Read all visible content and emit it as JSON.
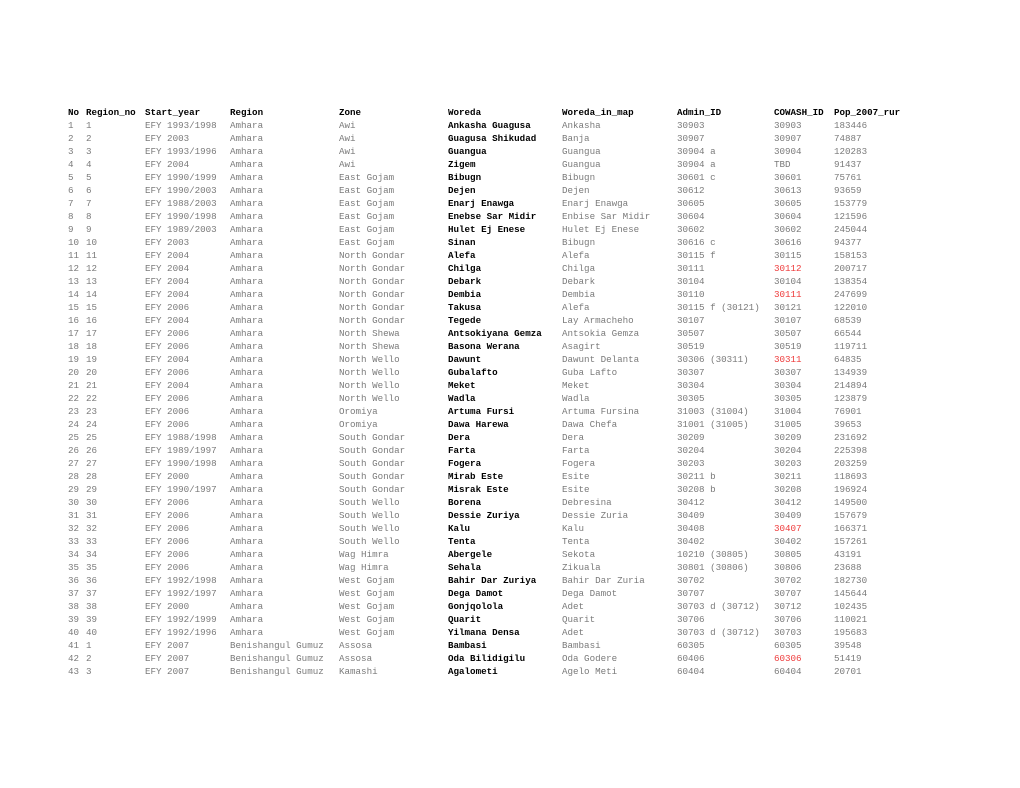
{
  "table": {
    "headers": [
      "No",
      "Region_no",
      "Start_year",
      "Region",
      "Zone",
      "Woreda",
      "Woreda_in_map",
      "Admin_ID",
      "COWASH_ID",
      "Pop_2007_rur"
    ],
    "flag_color": "#ee3b3b",
    "rows": [
      {
        "no": "1",
        "region_no": "1",
        "start_year": "EFY 1993/1998",
        "region": "Amhara",
        "zone": "Awi",
        "woreda": "Ankasha Guagusa",
        "woreda_in_map": "Ankasha",
        "admin_id": "30903",
        "cowash_id": "30903",
        "cowash_flag": false,
        "pop": "183446"
      },
      {
        "no": "2",
        "region_no": "2",
        "start_year": "EFY 2003",
        "region": "Amhara",
        "zone": "Awi",
        "woreda": "Guagusa Shikudad",
        "woreda_in_map": "Banja",
        "admin_id": "30907",
        "cowash_id": "30907",
        "cowash_flag": false,
        "pop": "74887"
      },
      {
        "no": "3",
        "region_no": "3",
        "start_year": "EFY 1993/1996",
        "region": "Amhara",
        "zone": "Awi",
        "woreda": "Guangua",
        "woreda_in_map": "Guangua",
        "admin_id": "30904 a",
        "cowash_id": "30904",
        "cowash_flag": false,
        "pop": "120283"
      },
      {
        "no": "4",
        "region_no": "4",
        "start_year": "EFY 2004",
        "region": "Amhara",
        "zone": "Awi",
        "woreda": "Zigem",
        "woreda_in_map": "Guangua",
        "admin_id": "30904 a",
        "cowash_id": "TBD",
        "cowash_flag": false,
        "pop": "91437"
      },
      {
        "no": "5",
        "region_no": "5",
        "start_year": "EFY 1990/1999",
        "region": "Amhara",
        "zone": "East Gojam",
        "woreda": "Bibugn",
        "woreda_in_map": "Bibugn",
        "admin_id": "30601 c",
        "cowash_id": "30601",
        "cowash_flag": false,
        "pop": "75761"
      },
      {
        "no": "6",
        "region_no": "6",
        "start_year": "EFY 1990/2003",
        "region": "Amhara",
        "zone": "East Gojam",
        "woreda": "Dejen",
        "woreda_in_map": "Dejen",
        "admin_id": "30612",
        "cowash_id": "30613",
        "cowash_flag": false,
        "pop": "93659"
      },
      {
        "no": "7",
        "region_no": "7",
        "start_year": "EFY 1988/2003",
        "region": "Amhara",
        "zone": "East Gojam",
        "woreda": "Enarj Enawga",
        "woreda_in_map": "Enarj Enawga",
        "admin_id": "30605",
        "cowash_id": "30605",
        "cowash_flag": false,
        "pop": "153779"
      },
      {
        "no": "8",
        "region_no": "8",
        "start_year": "EFY 1990/1998",
        "region": "Amhara",
        "zone": "East Gojam",
        "woreda": "Enebse Sar Midir",
        "woreda_in_map": "Enbise Sar Midir",
        "admin_id": "30604",
        "cowash_id": "30604",
        "cowash_flag": false,
        "pop": "121596"
      },
      {
        "no": "9",
        "region_no": "9",
        "start_year": "EFY 1989/2003",
        "region": "Amhara",
        "zone": "East Gojam",
        "woreda": "Hulet Ej Enese",
        "woreda_in_map": "Hulet Ej Enese",
        "admin_id": "30602",
        "cowash_id": "30602",
        "cowash_flag": false,
        "pop": "245044"
      },
      {
        "no": "10",
        "region_no": "10",
        "start_year": "EFY 2003",
        "region": "Amhara",
        "zone": "East Gojam",
        "woreda": "Sinan",
        "woreda_in_map": "Bibugn",
        "admin_id": "30616 c",
        "cowash_id": "30616",
        "cowash_flag": false,
        "pop": "94377"
      },
      {
        "no": "11",
        "region_no": "11",
        "start_year": "EFY 2004",
        "region": "Amhara",
        "zone": "North Gondar",
        "woreda": "Alefa",
        "woreda_in_map": "Alefa",
        "admin_id": "30115 f",
        "cowash_id": "30115",
        "cowash_flag": false,
        "pop": "158153"
      },
      {
        "no": "12",
        "region_no": "12",
        "start_year": "EFY 2004",
        "region": "Amhara",
        "zone": "North Gondar",
        "woreda": "Chilga",
        "woreda_in_map": "Chilga",
        "admin_id": "30111",
        "cowash_id": "30112",
        "cowash_flag": true,
        "pop": "200717"
      },
      {
        "no": "13",
        "region_no": "13",
        "start_year": "EFY 2004",
        "region": "Amhara",
        "zone": "North Gondar",
        "woreda": "Debark",
        "woreda_in_map": "Debark",
        "admin_id": "30104",
        "cowash_id": "30104",
        "cowash_flag": false,
        "pop": "138354"
      },
      {
        "no": "14",
        "region_no": "14",
        "start_year": "EFY 2004",
        "region": "Amhara",
        "zone": "North Gondar",
        "woreda": "Dembia",
        "woreda_in_map": "Dembia",
        "admin_id": "30110",
        "cowash_id": "30111",
        "cowash_flag": true,
        "pop": "247699"
      },
      {
        "no": "15",
        "region_no": "15",
        "start_year": "EFY 2006",
        "region": "Amhara",
        "zone": "North Gondar",
        "woreda": "Takusa",
        "woreda_in_map": "Alefa",
        "admin_id": "30115 f (30121)",
        "cowash_id": "30121",
        "cowash_flag": false,
        "pop": "122010"
      },
      {
        "no": "16",
        "region_no": "16",
        "start_year": "EFY 2004",
        "region": "Amhara",
        "zone": "North Gondar",
        "woreda": "Tegede",
        "woreda_in_map": "Lay Armacheho",
        "admin_id": "30107",
        "cowash_id": "30107",
        "cowash_flag": false,
        "pop": "68539"
      },
      {
        "no": "17",
        "region_no": "17",
        "start_year": "EFY 2006",
        "region": "Amhara",
        "zone": "North Shewa",
        "woreda": "Antsokiyana Gemza",
        "woreda_in_map": "Antsokia Gemza",
        "admin_id": "30507",
        "cowash_id": "30507",
        "cowash_flag": false,
        "pop": "66544"
      },
      {
        "no": "18",
        "region_no": "18",
        "start_year": "EFY 2006",
        "region": "Amhara",
        "zone": "North Shewa",
        "woreda": "Basona Werana",
        "woreda_in_map": "Asagirt",
        "admin_id": "30519",
        "cowash_id": "30519",
        "cowash_flag": false,
        "pop": "119711"
      },
      {
        "no": "19",
        "region_no": "19",
        "start_year": "EFY 2004",
        "region": "Amhara",
        "zone": "North Wello",
        "woreda": "Dawunt",
        "woreda_in_map": "Dawunt Delanta",
        "admin_id": "30306 (30311)",
        "cowash_id": "30311",
        "cowash_flag": true,
        "pop": "64835"
      },
      {
        "no": "20",
        "region_no": "20",
        "start_year": "EFY 2006",
        "region": "Amhara",
        "zone": "North Wello",
        "woreda": "Gubalafto",
        "woreda_in_map": "Guba Lafto",
        "admin_id": "30307",
        "cowash_id": "30307",
        "cowash_flag": false,
        "pop": "134939"
      },
      {
        "no": "21",
        "region_no": "21",
        "start_year": "EFY 2004",
        "region": "Amhara",
        "zone": "North Wello",
        "woreda": "Meket",
        "woreda_in_map": "Meket",
        "admin_id": "30304",
        "cowash_id": "30304",
        "cowash_flag": false,
        "pop": "214894"
      },
      {
        "no": "22",
        "region_no": "22",
        "start_year": "EFY 2006",
        "region": "Amhara",
        "zone": "North Wello",
        "woreda": "Wadla",
        "woreda_in_map": "Wadla",
        "admin_id": "30305",
        "cowash_id": "30305",
        "cowash_flag": false,
        "pop": "123879"
      },
      {
        "no": "23",
        "region_no": "23",
        "start_year": "EFY 2006",
        "region": "Amhara",
        "zone": "Oromiya",
        "woreda": "Artuma Fursi",
        "woreda_in_map": "Artuma Fursina",
        "admin_id": "31003 (31004)",
        "cowash_id": "31004",
        "cowash_flag": false,
        "pop": "76901"
      },
      {
        "no": "24",
        "region_no": "24",
        "start_year": "EFY 2006",
        "region": "Amhara",
        "zone": "Oromiya",
        "woreda": "Dawa Harewa",
        "woreda_in_map": "Dawa Chefa",
        "admin_id": "31001 (31005)",
        "cowash_id": "31005",
        "cowash_flag": false,
        "pop": "39653"
      },
      {
        "no": "25",
        "region_no": "25",
        "start_year": "EFY 1988/1998",
        "region": "Amhara",
        "zone": "South Gondar",
        "woreda": "Dera",
        "woreda_in_map": "Dera",
        "admin_id": "30209",
        "cowash_id": "30209",
        "cowash_flag": false,
        "pop": "231692"
      },
      {
        "no": "26",
        "region_no": "26",
        "start_year": "EFY 1989/1997",
        "region": "Amhara",
        "zone": "South Gondar",
        "woreda": "Farta",
        "woreda_in_map": "Farta",
        "admin_id": "30204",
        "cowash_id": "30204",
        "cowash_flag": false,
        "pop": "225398"
      },
      {
        "no": "27",
        "region_no": "27",
        "start_year": "EFY 1990/1998",
        "region": "Amhara",
        "zone": "South Gondar",
        "woreda": "Fogera",
        "woreda_in_map": "Fogera",
        "admin_id": "30203",
        "cowash_id": "30203",
        "cowash_flag": false,
        "pop": "203259"
      },
      {
        "no": "28",
        "region_no": "28",
        "start_year": "EFY 2000",
        "region": "Amhara",
        "zone": "South Gondar",
        "woreda": "Mirab Este",
        "woreda_in_map": "Esite",
        "admin_id": "30211 b",
        "cowash_id": "30211",
        "cowash_flag": false,
        "pop": "118693"
      },
      {
        "no": "29",
        "region_no": "29",
        "start_year": "EFY 1990/1997",
        "region": "Amhara",
        "zone": "South Gondar",
        "woreda": "Misrak Este",
        "woreda_in_map": "Esite",
        "admin_id": "30208 b",
        "cowash_id": "30208",
        "cowash_flag": false,
        "pop": "196924"
      },
      {
        "no": "30",
        "region_no": "30",
        "start_year": "EFY 2006",
        "region": "Amhara",
        "zone": "South Wello",
        "woreda": "Borena",
        "woreda_in_map": "Debresina",
        "admin_id": "30412",
        "cowash_id": "30412",
        "cowash_flag": false,
        "pop": "149500"
      },
      {
        "no": "31",
        "region_no": "31",
        "start_year": "EFY 2006",
        "region": "Amhara",
        "zone": "South Wello",
        "woreda": "Dessie Zuriya",
        "woreda_in_map": "Dessie Zuria",
        "admin_id": "30409",
        "cowash_id": "30409",
        "cowash_flag": false,
        "pop": "157679"
      },
      {
        "no": "32",
        "region_no": "32",
        "start_year": "EFY 2006",
        "region": "Amhara",
        "zone": "South Wello",
        "woreda": "Kalu",
        "woreda_in_map": "Kalu",
        "admin_id": "30408",
        "cowash_id": "30407",
        "cowash_flag": true,
        "pop": "166371"
      },
      {
        "no": "33",
        "region_no": "33",
        "start_year": "EFY 2006",
        "region": "Amhara",
        "zone": "South Wello",
        "woreda": "Tenta",
        "woreda_in_map": "Tenta",
        "admin_id": "30402",
        "cowash_id": "30402",
        "cowash_flag": false,
        "pop": "157261"
      },
      {
        "no": "34",
        "region_no": "34",
        "start_year": "EFY 2006",
        "region": "Amhara",
        "zone": "Wag Himra",
        "woreda": "Abergele",
        "woreda_in_map": "Sekota",
        "admin_id": "10210 (30805)",
        "cowash_id": "30805",
        "cowash_flag": false,
        "pop": "43191"
      },
      {
        "no": "35",
        "region_no": "35",
        "start_year": "EFY 2006",
        "region": "Amhara",
        "zone": "Wag Himra",
        "woreda": "Sehala",
        "woreda_in_map": "Zikuala",
        "admin_id": "30801 (30806)",
        "cowash_id": "30806",
        "cowash_flag": false,
        "pop": "23688"
      },
      {
        "no": "36",
        "region_no": "36",
        "start_year": "EFY 1992/1998",
        "region": "Amhara",
        "zone": "West Gojam",
        "woreda": "Bahir Dar Zuriya",
        "woreda_in_map": "Bahir Dar Zuria",
        "admin_id": "30702",
        "cowash_id": "30702",
        "cowash_flag": false,
        "pop": "182730"
      },
      {
        "no": "37",
        "region_no": "37",
        "start_year": "EFY 1992/1997",
        "region": "Amhara",
        "zone": "West Gojam",
        "woreda": "Dega Damot",
        "woreda_in_map": "Dega Damot",
        "admin_id": "30707",
        "cowash_id": "30707",
        "cowash_flag": false,
        "pop": "145644"
      },
      {
        "no": "38",
        "region_no": "38",
        "start_year": "EFY 2000",
        "region": "Amhara",
        "zone": "West Gojam",
        "woreda": "Gonjqolola",
        "woreda_in_map": "Adet",
        "admin_id": "30703 d (30712)",
        "cowash_id": "30712",
        "cowash_flag": false,
        "pop": "102435"
      },
      {
        "no": "39",
        "region_no": "39",
        "start_year": "EFY 1992/1999",
        "region": "Amhara",
        "zone": "West Gojam",
        "woreda": "Quarit",
        "woreda_in_map": "Quarit",
        "admin_id": "30706",
        "cowash_id": "30706",
        "cowash_flag": false,
        "pop": "110021"
      },
      {
        "no": "40",
        "region_no": "40",
        "start_year": "EFY 1992/1996",
        "region": "Amhara",
        "zone": "West Gojam",
        "woreda": "Yilmana Densa",
        "woreda_in_map": "Adet",
        "admin_id": "30703 d (30712)",
        "cowash_id": "30703",
        "cowash_flag": false,
        "pop": "195683"
      },
      {
        "no": "41",
        "region_no": "1",
        "start_year": "EFY 2007",
        "region": "Benishangul Gumuz",
        "zone": "Assosa",
        "woreda": "Bambasi",
        "woreda_in_map": "Bambasi",
        "admin_id": "60305",
        "cowash_id": "60305",
        "cowash_flag": false,
        "pop": "39548"
      },
      {
        "no": "42",
        "region_no": "2",
        "start_year": "EFY 2007",
        "region": "Benishangul Gumuz",
        "zone": "Assosa",
        "woreda": "Oda Bilidigilu",
        "woreda_in_map": "Oda Godere",
        "admin_id": "60406",
        "cowash_id": "60306",
        "cowash_flag": true,
        "pop": "51419"
      },
      {
        "no": "43",
        "region_no": "3",
        "start_year": "EFY 2007",
        "region": "Benishangul Gumuz",
        "zone": "Kamashi",
        "woreda": "Agalometi",
        "woreda_in_map": "Agelo Meti",
        "admin_id": "60404",
        "cowash_id": "60404",
        "cowash_flag": false,
        "pop": "20701"
      }
    ]
  }
}
